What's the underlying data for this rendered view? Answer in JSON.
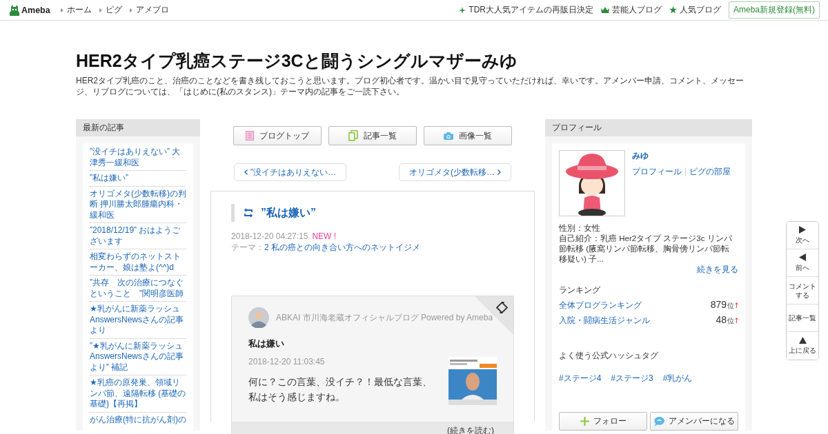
{
  "top_bar": {
    "logo": "Ameba",
    "links": [
      "ホーム",
      "ピグ",
      "アメブロ"
    ],
    "right_links": [
      {
        "kind": "sparkle",
        "label": "TDR大人気アイテムの再販日決定"
      },
      {
        "kind": "crown",
        "label": "芸能人ブログ"
      },
      {
        "kind": "star",
        "label": "人気ブログ"
      }
    ],
    "signup_button": "Ameba新規登録(無料)"
  },
  "blog": {
    "title": "HER2タイプ乳癌ステージ3Cと闘うシングルマザーみゆ",
    "description": "HER2タイプ乳癌のこと、治癌のことなどを書き残しておこうと思います。ブログ初心者です。温かい目で見守っていただければ、幸いです。アメンバー申請、コメント、メッセージ、リブログについては、「はじめに(私のスタンス)」テーマ内の記事をご一読下さい。"
  },
  "recent_articles": {
    "heading": "最新の記事",
    "items": [
      "”没イチはありえない” 大津秀一緩和医",
      "”私は嫌い”",
      "オリゴメタ(少数転移)の判断 押川勝太郎腫瘍内科・緩和医",
      "”2018/12/19” おはようございます",
      "相変わらずのネットストーカー、娘は塾よ(^^)d",
      "”共存　次の治療につなぐということ　”関明彦医師",
      "★乳がんに新薬ラッシュ AnswersNewsさんの記事より",
      "”★乳がんに新薬ラッシュ AnswersNewsさんの記事より” 補記",
      "★乳癌の原発巣、領域リンパ節、遠隔転移 (基礎の基礎)【再掲】",
      "がん治療(特に抗がん剤)の"
    ]
  },
  "blog_nav": [
    {
      "kind": "top",
      "label": "ブログトップ"
    },
    {
      "kind": "list",
      "label": "記事一覧"
    },
    {
      "label": "画像一覧"
    }
  ],
  "pager": {
    "previous": "”没イチはありえない…",
    "next": "オリゴメタ(少数転移…"
  },
  "article": {
    "title": "”私は嫌い”",
    "date": "2018-12-20 04:27:15",
    "new_badge": "NEW !",
    "theme_label": "テーマ：",
    "theme": "2 私の癌との向き合い方へのネットイジメ",
    "reblog": {
      "source": "ABKAI 市川海老蔵オフィシャルブログ Powered by Ameba",
      "title": "私は嫌い",
      "date": "2018-12-20 11:03:45",
      "excerpt": "何に？この言葉、没イチ？！最低な言葉、私はそう感じますね。",
      "read_more": "(続きを読む)"
    }
  },
  "profile": {
    "heading": "プロフィール",
    "name": "みゆ",
    "links": [
      "プロフィール",
      "ピグの部屋"
    ],
    "gender": "性別：女性",
    "intro": "自己紹介：乳癌 Her2タイプ ステージ3c リンパ節転移 (腋窩リンパ節転移、胸骨傍リンパ節転移疑い) 子...",
    "more": "続きを見る",
    "ranking_heading": "ランキング",
    "rankings": [
      {
        "label": "全体ブログランキング",
        "rank": "879",
        "unit": "位"
      },
      {
        "label": "入院・闘病生活ジャンル",
        "rank": "48",
        "unit": "位"
      }
    ],
    "hashtag_heading": "よく使う公式ハッシュタグ",
    "hashtags": [
      "#ステージ4",
      "#ステージ3",
      "#乳がん"
    ],
    "buttons": [
      {
        "kind": "follow",
        "label": "フォロー"
      },
      {
        "kind": "amember",
        "label": "アメンバーになる"
      }
    ]
  },
  "float_nav": [
    {
      "kind": "next",
      "label": "次へ"
    },
    {
      "kind": "prev",
      "label": "前へ"
    },
    {
      "kind": "text",
      "label": "コメントする"
    },
    {
      "kind": "text",
      "label": "記事一覧"
    },
    {
      "kind": "up",
      "label": "上に戻る"
    }
  ]
}
